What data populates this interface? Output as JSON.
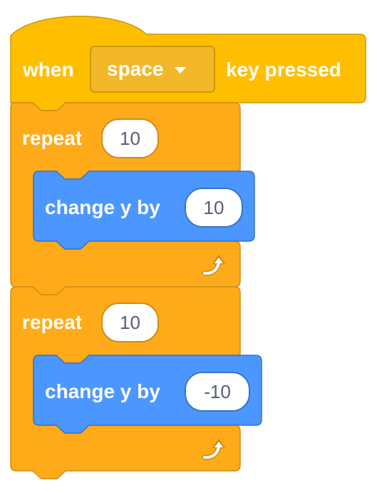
{
  "event_block": {
    "label_before": "when",
    "key_value": "space",
    "label_after": "key pressed"
  },
  "repeat_blocks": [
    {
      "label": "repeat",
      "times": "10",
      "inner": {
        "label": "change y by",
        "value": "10"
      }
    },
    {
      "label": "repeat",
      "times": "10",
      "inner": {
        "label": "change y by",
        "value": "-10"
      }
    }
  ],
  "colors": {
    "events": "#ffbf00",
    "control": "#ffab19",
    "motion": "#4c97ff"
  },
  "icons": {
    "loop": "loop-arrow-icon",
    "dropdown": "dropdown-arrow-icon"
  }
}
